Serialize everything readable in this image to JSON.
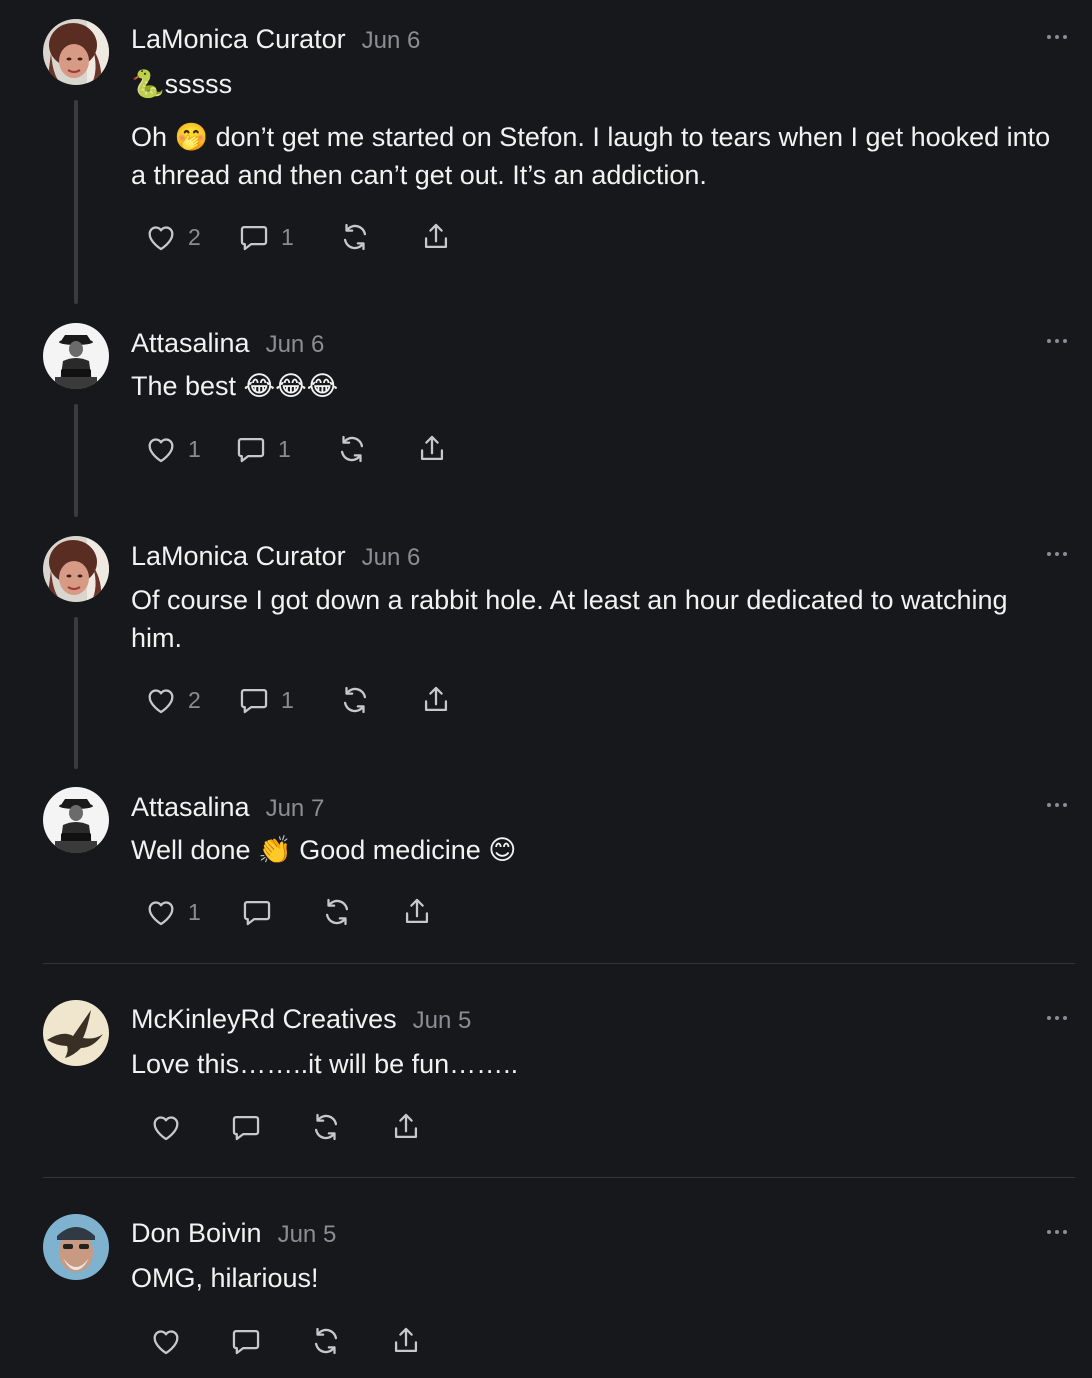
{
  "comments": [
    {
      "author": "LaMonica Curator",
      "date": "Jun 6",
      "avatar_icon": "woman-portrait-avatar",
      "paragraphs": [
        "🐍sssss",
        "Oh 🤭 don’t get me started on Stefon. I laugh to tears when I get hooked into a thread and then can’t get out. It’s an addiction."
      ],
      "likes": "2",
      "replies": "1"
    },
    {
      "author": "Attasalina",
      "date": "Jun 6",
      "avatar_icon": "musician-portrait-avatar",
      "paragraphs": [
        "The best 😂😂😂"
      ],
      "likes": "1",
      "replies": "1"
    },
    {
      "author": "LaMonica Curator",
      "date": "Jun 6",
      "avatar_icon": "woman-portrait-avatar",
      "paragraphs": [
        "Of course I got down a rabbit hole. At least an hour dedicated to watching him."
      ],
      "likes": "2",
      "replies": "1"
    },
    {
      "author": "Attasalina",
      "date": "Jun 7",
      "avatar_icon": "musician-portrait-avatar",
      "paragraphs": [
        "Well done 👏 Good medicine 😊"
      ],
      "likes": "1",
      "replies": ""
    },
    {
      "author": "McKinleyRd Creatives",
      "date": "Jun 5",
      "avatar_icon": "eagle-avatar",
      "paragraphs": [
        "Love this……..it will be fun…….."
      ],
      "likes": "",
      "replies": ""
    },
    {
      "author": "Don Boivin",
      "date": "Jun 5",
      "avatar_icon": "man-with-cap-avatar",
      "paragraphs": [
        "OMG, hilarious!"
      ],
      "likes": "",
      "replies": ""
    }
  ],
  "icons": {
    "like": "heart-icon",
    "reply": "comment-bubble-icon",
    "restack": "restack-icon",
    "share": "share-icon",
    "more": "more-options-icon"
  },
  "colors": {
    "background": "#17181b",
    "text": "#f2f2f2",
    "muted": "#8b8d92",
    "thread_line": "#3a3b3f"
  }
}
